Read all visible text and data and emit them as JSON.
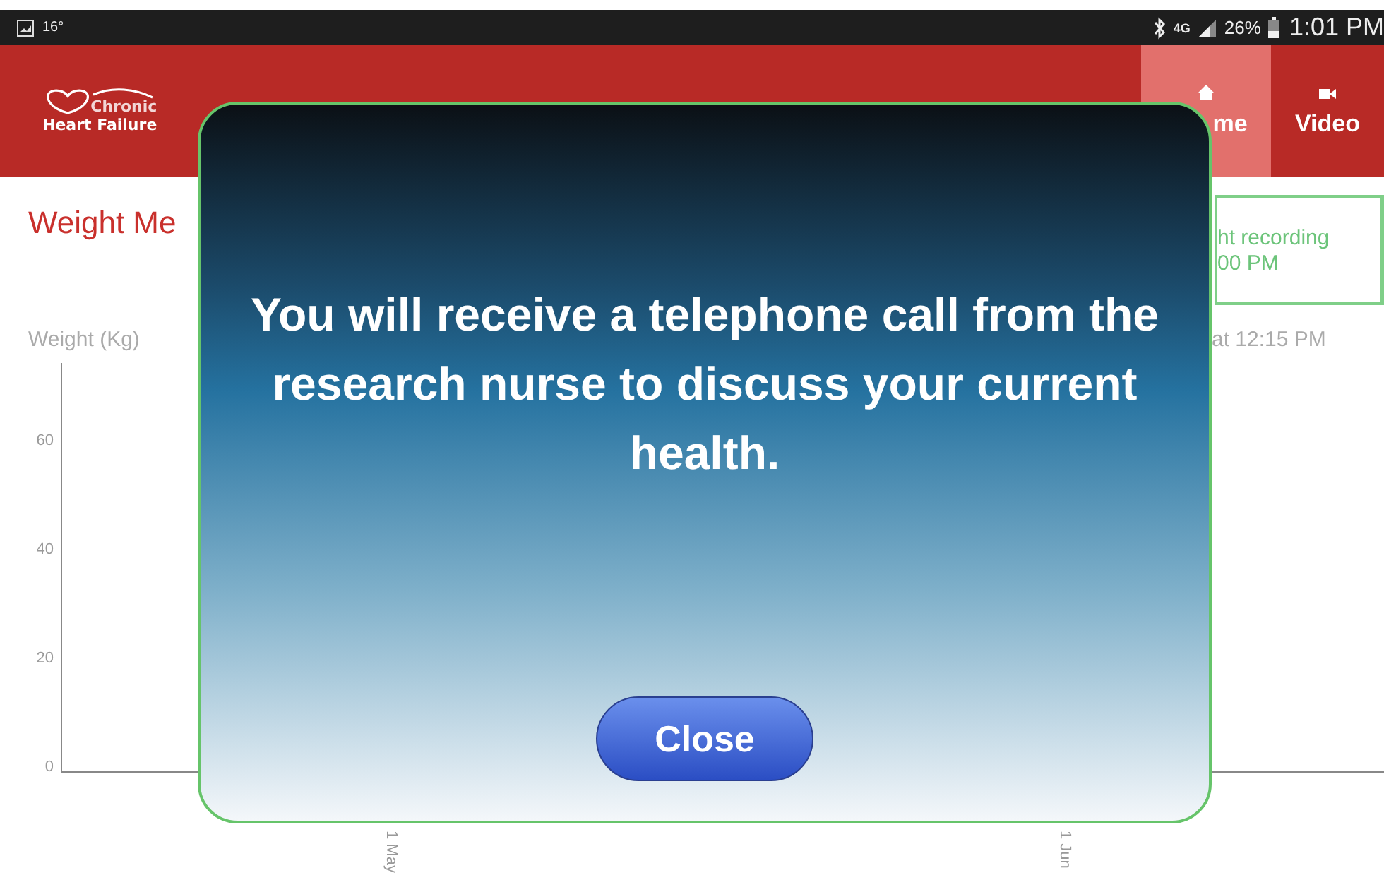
{
  "status_bar": {
    "temperature": "16°",
    "network": "4G",
    "battery": "26%",
    "time": "1:01 PM"
  },
  "header": {
    "logo": {
      "line1": "Chronic",
      "line2": "Heart Failure"
    },
    "tabs": [
      {
        "label": "me",
        "selected": true
      },
      {
        "label": "Video",
        "selected": false
      }
    ]
  },
  "page_title": "Weight Me",
  "reminder": {
    "lines": [
      "ht recording",
      "00 PM"
    ]
  },
  "last_reading": "at 12:15 PM",
  "chart": {
    "ylabel": "Weight (Kg)",
    "yticks": [
      "60",
      "40",
      "20",
      "0"
    ],
    "xticks": [
      "1 May",
      "1 Jun"
    ]
  },
  "dialog": {
    "message": "You will receive a telephone call from the research nurse to discuss your current health.",
    "button": "Close"
  }
}
